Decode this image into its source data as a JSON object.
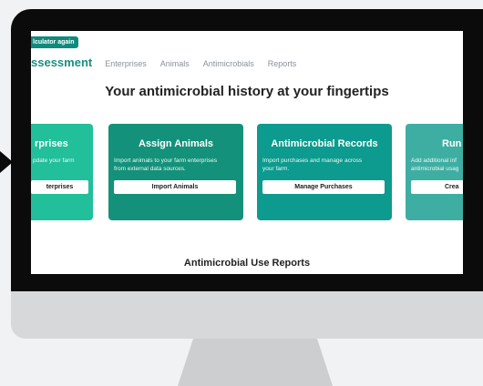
{
  "app": {
    "badge": "lculator again",
    "brand": "ssessment",
    "nav": [
      "Enterprises",
      "Animals",
      "Antimicrobials",
      "Reports"
    ]
  },
  "hero": {
    "title": "Your antimicrobial history at your fingertips"
  },
  "cards": [
    {
      "title": "rprises",
      "text": "pdate your farm",
      "button": "terprises",
      "color": "#21bf9a"
    },
    {
      "title": "Assign Animals",
      "text": "Import animals to your farm enterprises\nfrom external data sources.",
      "button": "Import Animals",
      "color": "#14917a"
    },
    {
      "title": "Antimicrobial Records",
      "text": "Import purchases and manage across\nyour farm.",
      "button": "Manage Purchases",
      "color": "#0c9b8e"
    },
    {
      "title": "Run",
      "text": "Add additional inf\nantimicrobial usag",
      "button": "Crea",
      "color": "#3eaea2"
    }
  ],
  "reports": {
    "title": "Antimicrobial Use Reports"
  }
}
